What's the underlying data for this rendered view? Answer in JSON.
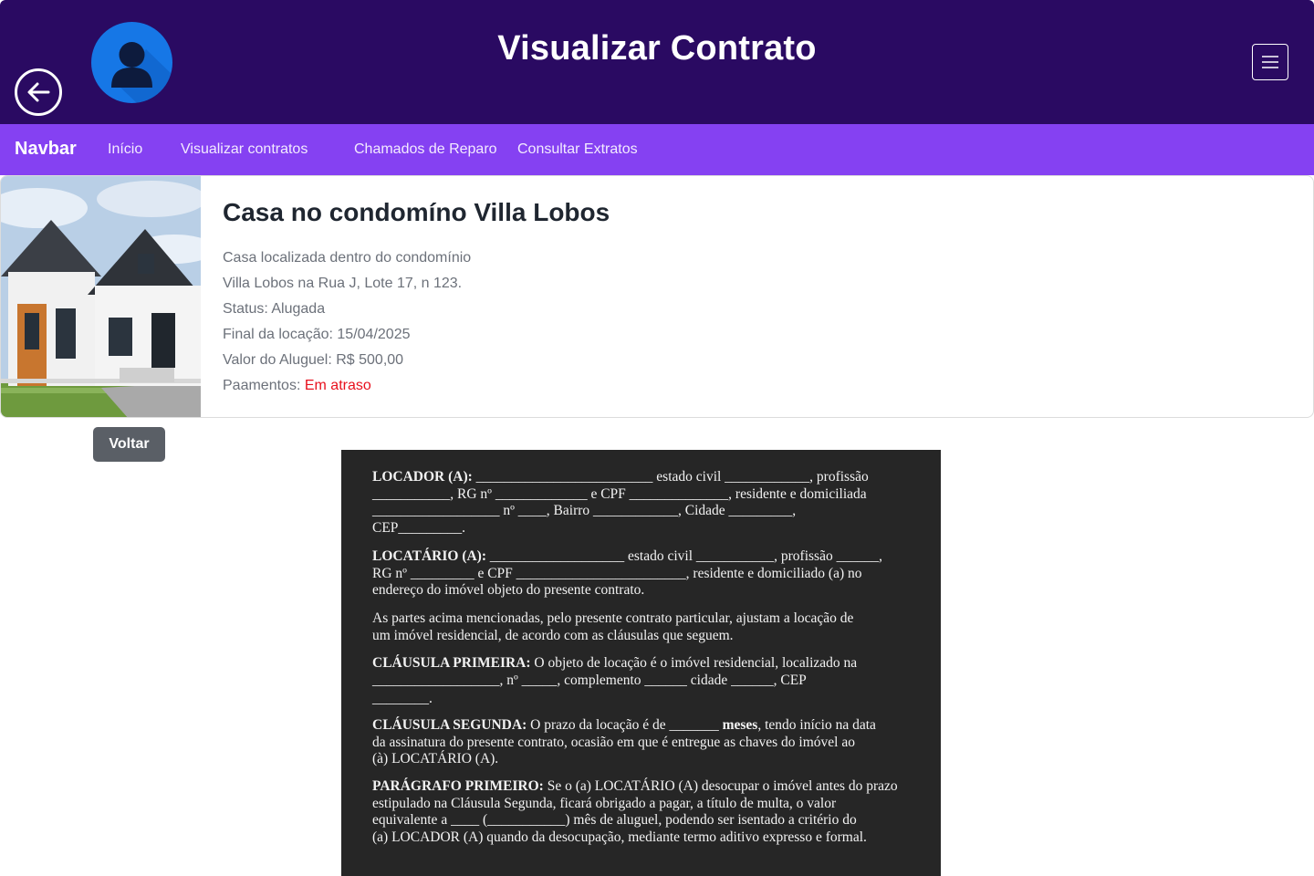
{
  "header": {
    "title": "Visualizar Contrato",
    "back_icon": "arrow-left-icon",
    "avatar_icon": "user-avatar-icon",
    "menu_icon": "hamburger-menu-icon",
    "background_color": "#2a0a62"
  },
  "navbar": {
    "brand": "Navbar",
    "links": [
      "Início",
      "Visualizar contratos",
      "Chamados de Reparo",
      "Consultar Extratos"
    ],
    "background_color": "#8541f2"
  },
  "property": {
    "title": "Casa no condomíno Villa Lobos",
    "description_line1": "Casa localizada dentro do condomínio",
    "description_line2": "Villa Lobos na Rua J, Lote 17, n 123.",
    "status": "Status: Alugada",
    "lease_end": "Final da locação: 15/04/2025",
    "rent_value": "Valor do Aluguel: R$ 500,00",
    "payments_label": "Paamentos:",
    "payments_status": "Em atraso",
    "payments_status_color": "#e8101d"
  },
  "actions": {
    "back_label": "Voltar"
  },
  "contract": {
    "locador": {
      "label": "LOCADOR (A):",
      "line1": " _________________________ estado civil ____________, profissão",
      "line2": "___________, RG nº _____________ e CPF ______________, residente e domiciliada",
      "line3": "__________________ nº ____, Bairro ____________, Cidade _________,",
      "line4": "CEP_________."
    },
    "locatario": {
      "label": "LOCATÁRIO (A):",
      "line1": " ___________________ estado civil ___________, profissão ______,",
      "line2": "RG nº _________ e CPF ________________________, residente e domiciliado (a) no",
      "line3": "endereço do imóvel objeto do presente contrato."
    },
    "intro": {
      "line1": "As partes acima mencionadas, pelo presente contrato particular, ajustam a locação de",
      "line2": "um imóvel residencial, de acordo com as cláusulas que seguem."
    },
    "clausula1": {
      "label": "CLÁUSULA PRIMEIRA:",
      "line1": " O objeto de locação é o imóvel residencial, localizado na",
      "line2": "__________________, nº _____, complemento ______ cidade ______, CEP",
      "line3": "________."
    },
    "clausula2": {
      "label": "CLÁUSULA SEGUNDA:",
      "line1_a": " O prazo da locação é de _______ ",
      "line1_b": "meses",
      "line1_c": ", tendo início na data",
      "line2": "da assinatura do presente contrato, ocasião em que é entregue as chaves do imóvel ao",
      "line3": "(à) LOCATÁRIO (A)."
    },
    "paragrafo1": {
      "label": "PARÁGRAFO PRIMEIRO:",
      "line1": " Se o (a) LOCATÁRIO (A) desocupar o imóvel antes do prazo",
      "line2": "estipulado na Cláusula Segunda, ficará obrigado a pagar, a título de multa, o valor",
      "line3": "equivalente a ____ (___________) mês de aluguel, podendo ser isentado a critério do",
      "line4": "(a) LOCADOR (A) quando da desocupação, mediante termo aditivo expresso e formal."
    }
  }
}
